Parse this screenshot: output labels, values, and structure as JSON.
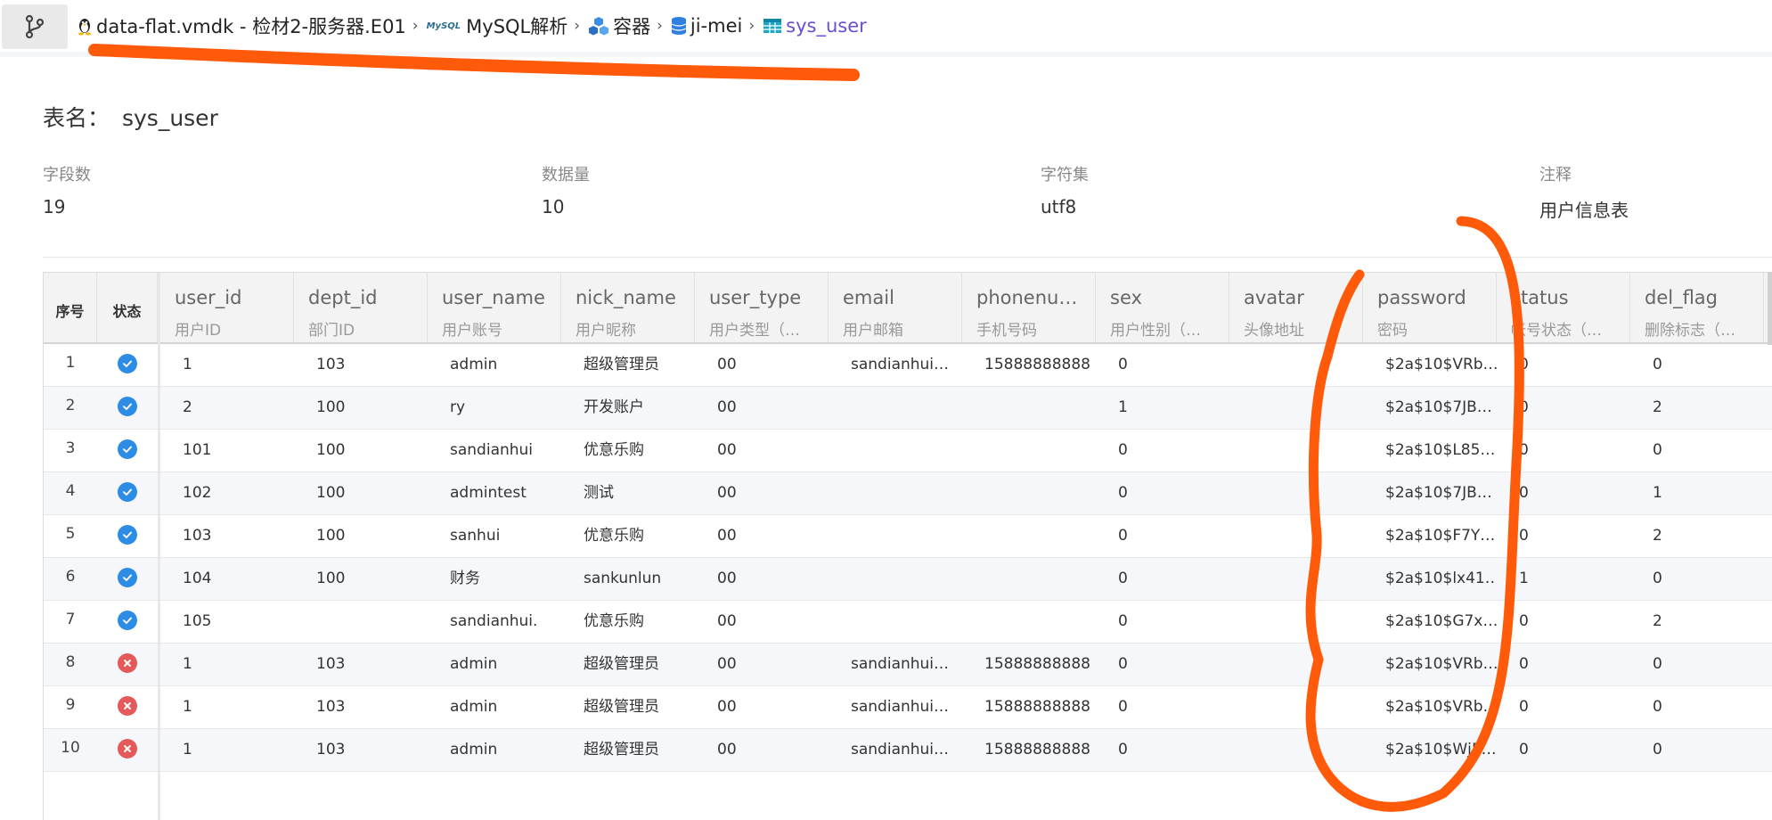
{
  "breadcrumb": {
    "items": [
      {
        "label": "data-flat.vmdk - 检材2-服务器.E01",
        "icon": "linux-penguin-icon"
      },
      {
        "label": "MySQL解析",
        "icon": "mysql-logo-icon",
        "logo_text": "MySQL"
      },
      {
        "label": "容器",
        "icon": "cubes-icon"
      },
      {
        "label": "ji-mei",
        "icon": "database-icon"
      },
      {
        "label": "sys_user",
        "icon": "table-icon"
      }
    ]
  },
  "table_info": {
    "title_label": "表名：",
    "title_value": "sys_user",
    "field_count_label": "字段数",
    "field_count": "19",
    "row_count_label": "数据量",
    "row_count": "10",
    "charset_label": "字符集",
    "charset": "utf8",
    "comment_label": "注释",
    "comment": "用户信息表"
  },
  "grid": {
    "fixed_headers": [
      "序号",
      "状态"
    ],
    "columns": [
      {
        "name": "user_id",
        "comment": "用户ID"
      },
      {
        "name": "dept_id",
        "comment": "部门ID"
      },
      {
        "name": "user_name",
        "comment": "用户账号"
      },
      {
        "name": "nick_name",
        "comment": "用户昵称"
      },
      {
        "name": "user_type",
        "comment": "用户类型（…"
      },
      {
        "name": "email",
        "comment": "用户邮箱"
      },
      {
        "name": "phonenu…",
        "comment": "手机号码"
      },
      {
        "name": "sex",
        "comment": "用户性别（…"
      },
      {
        "name": "avatar",
        "comment": "头像地址"
      },
      {
        "name": "password",
        "comment": "密码"
      },
      {
        "name": "status",
        "comment": "帐号状态（…"
      },
      {
        "name": "del_flag",
        "comment": "删除标志（…"
      }
    ],
    "rows": [
      {
        "index": "1",
        "status": "ok",
        "cells": [
          "1",
          "103",
          "admin",
          "超级管理员",
          "00",
          "sandianhui…",
          "15888888888",
          "0",
          "",
          "$2a$10$VRb…",
          "0",
          "0"
        ]
      },
      {
        "index": "2",
        "status": "ok",
        "cells": [
          "2",
          "100",
          "ry",
          "开发账户",
          "00",
          "",
          "",
          "1",
          "",
          "$2a$10$7JB…",
          "0",
          "2"
        ]
      },
      {
        "index": "3",
        "status": "ok",
        "cells": [
          "101",
          "100",
          "sandianhui",
          "优意乐购",
          "00",
          "",
          "",
          "0",
          "",
          "$2a$10$L85…",
          "0",
          "0"
        ]
      },
      {
        "index": "4",
        "status": "ok",
        "cells": [
          "102",
          "100",
          "admintest",
          "测试",
          "00",
          "",
          "",
          "0",
          "",
          "$2a$10$7JB…",
          "0",
          "1"
        ]
      },
      {
        "index": "5",
        "status": "ok",
        "cells": [
          "103",
          "100",
          "sanhui",
          "优意乐购",
          "00",
          "",
          "",
          "0",
          "",
          "$2a$10$F7Y…",
          "0",
          "2"
        ]
      },
      {
        "index": "6",
        "status": "ok",
        "cells": [
          "104",
          "100",
          "财务",
          "sankunlun",
          "00",
          "",
          "",
          "0",
          "",
          "$2a$10$lx41…",
          "1",
          "0"
        ]
      },
      {
        "index": "7",
        "status": "ok",
        "cells": [
          "105",
          "",
          "sandianhui.",
          "优意乐购",
          "00",
          "",
          "",
          "0",
          "",
          "$2a$10$G7x…",
          "0",
          "2"
        ]
      },
      {
        "index": "8",
        "status": "error",
        "cells": [
          "1",
          "103",
          "admin",
          "超级管理员",
          "00",
          "sandianhui…",
          "15888888888",
          "0",
          "",
          "$2a$10$VRb…",
          "0",
          "0"
        ]
      },
      {
        "index": "9",
        "status": "error",
        "cells": [
          "1",
          "103",
          "admin",
          "超级管理员",
          "00",
          "sandianhui…",
          "15888888888",
          "0",
          "",
          "$2a$10$VRb…",
          "0",
          "0"
        ]
      },
      {
        "index": "10",
        "status": "error",
        "cells": [
          "1",
          "103",
          "admin",
          "超级管理员",
          "00",
          "sandianhui…",
          "15888888888",
          "0",
          "",
          "$2a$10$Wj5…",
          "0",
          "0"
        ]
      }
    ]
  },
  "colors": {
    "accent": "#6a4fd0",
    "ok_status": "#2c8ce6",
    "error_status": "#e45a5a",
    "annotation": "#ff5a0a"
  }
}
